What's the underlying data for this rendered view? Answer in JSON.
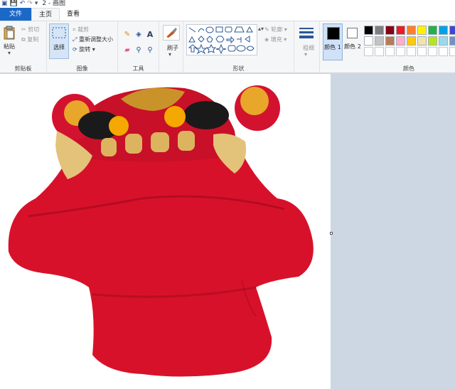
{
  "titlebar": {
    "title": "2 - 画图"
  },
  "tabs": [
    {
      "label": "文件"
    },
    {
      "label": "主页"
    },
    {
      "label": "查看"
    }
  ],
  "ribbon": {
    "clipboard": {
      "paste": "粘贴",
      "cut": "剪切",
      "copy": "复制",
      "label": "剪贴板"
    },
    "image": {
      "select": "选择",
      "crop": "裁剪",
      "resize": "重新调整大小",
      "rotate": "旋转",
      "label": "图像"
    },
    "tools": {
      "label": "工具"
    },
    "brush": {
      "label": "刷子"
    },
    "shapes": {
      "outline": "轮廓",
      "fill": "填充",
      "label": "形状"
    },
    "size": {
      "label": "粗细"
    },
    "color1": {
      "label": "颜色 1"
    },
    "color2": {
      "label": "颜色 2"
    },
    "colors": {
      "label": "颜色",
      "palette_row1": [
        "#000000",
        "#7f7f7f",
        "#880015",
        "#ed1c24",
        "#ff7f27",
        "#fff200",
        "#22b14c",
        "#00a2e8",
        "#3f48cc"
      ],
      "palette_row2": [
        "#ffffff",
        "#c3c3c3",
        "#b97a57",
        "#ffaec9",
        "#ffc90e",
        "#efe4b0",
        "#b5e61d",
        "#99d9ea",
        "#7092be"
      ]
    }
  },
  "canvas": {
    "subject": "red embroidered tiger-head toy"
  }
}
